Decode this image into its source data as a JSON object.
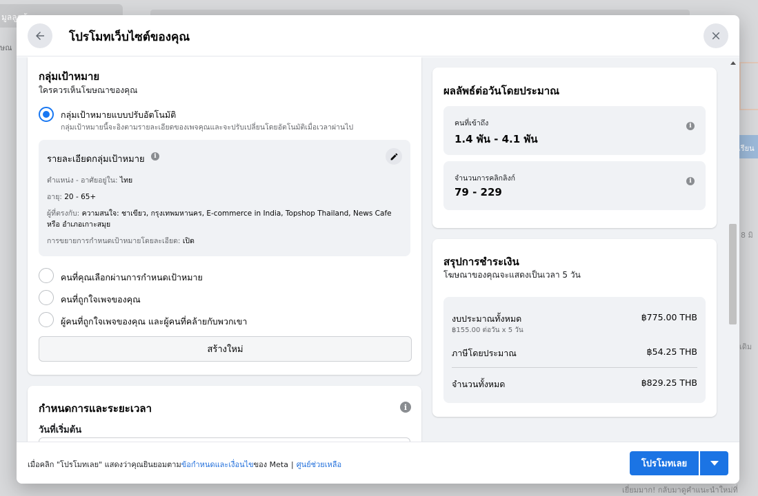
{
  "background": {
    "top_left_text": "มูลลูกค้า",
    "left_text": "ษณ",
    "right_button": "เรียน",
    "right_text_1": "8 มิ",
    "right_text_2": "เดิม",
    "bottom_text": "เยี่ยมมาก! กลับมาดูคำแนะนำใหม่ที่"
  },
  "header": {
    "title": "โปรโมทเว็บไซต์ของคุณ"
  },
  "audience": {
    "title": "กลุ่มเป้าหมาย",
    "subtitle": "ใครควรเห็นโฆษณาของคุณ",
    "options": [
      {
        "label": "กลุ่มเป้าหมายแบบปรับอัตโนมัติ",
        "description": "กลุ่มเป้าหมายนี้จะอิงตามรายละเอียดของเพจคุณและจะปรับเปลี่ยนโดยอัตโนมัติเมื่อเวลาผ่านไป",
        "selected": true
      },
      {
        "label": "คนที่คุณเลือกผ่านการกำหนดเป้าหมาย",
        "selected": false
      },
      {
        "label": "คนที่ถูกใจเพจของคุณ",
        "selected": false
      },
      {
        "label": "ผู้คนที่ถูกใจเพจของคุณ และผู้คนที่คล้ายกับพวกเขา",
        "selected": false
      }
    ],
    "details": {
      "title": "รายละเอียดกลุ่มเป้าหมาย",
      "location_label": "ตำแหน่ง - อาศัยอยู่ใน:",
      "location_value": "ไทย",
      "age_label": "อายุ:",
      "age_value": "20 - 65+",
      "match_label": "ผู้ที่ตรงกับ:",
      "match_value": "ความสนใจ: ชาเขียว, กรุงเทพมหานคร, E-commerce in India, Topshop Thailand, News Cafe หรือ อำเภอเกาะสมุย",
      "expansion_label": "การขยายการกำหนดเป้าหมายโดยละเอียด:",
      "expansion_value": "เปิด"
    },
    "create_new_label": "สร้างใหม่"
  },
  "schedule": {
    "title": "กำหนดการและระยะเวลา",
    "start_date_label": "วันที่เริ่มต้น"
  },
  "results": {
    "title": "ผลลัพธ์ต่อวันโดยประมาณ",
    "metrics": [
      {
        "label": "คนที่เข้าถึง",
        "value": "1.4 พัน - 4.1 พัน"
      },
      {
        "label": "จำนวนการคลิกลิงก์",
        "value": "79 - 229"
      }
    ]
  },
  "payment": {
    "title": "สรุปการชำระเงิน",
    "subtitle": "โฆษณาของคุณจะแสดงเป็นเวลา 5 วัน",
    "total_budget_label": "งบประมาณทั้งหมด",
    "total_budget_value": "฿775.00 THB",
    "total_budget_sub": "฿155.00 ต่อวัน x 5 วัน",
    "tax_label": "ภาษีโดยประมาณ",
    "tax_value": "฿54.25 THB",
    "total_label": "จำนวนทั้งหมด",
    "total_value": "฿829.25 THB"
  },
  "footer": {
    "text_prefix": "เมื่อคลิก \"โปรโมทเลย\" แสดงว่าคุณยินยอมตาม",
    "terms_link": "ข้อกำหนดและเงื่อนไข",
    "text_suffix": "ของ Meta",
    "separator": "|",
    "help_link": "ศูนย์ช่วยเหลือ",
    "promote_label": "โปรโมทเลย"
  },
  "icons": {
    "back": "arrow-left-icon",
    "close": "close-icon",
    "edit": "pencil-icon",
    "info": "info-icon",
    "dropdown": "caret-down-icon"
  },
  "colors": {
    "primary": "#1b74e4",
    "link": "#216fdb",
    "surface": "#f0f2f5"
  }
}
